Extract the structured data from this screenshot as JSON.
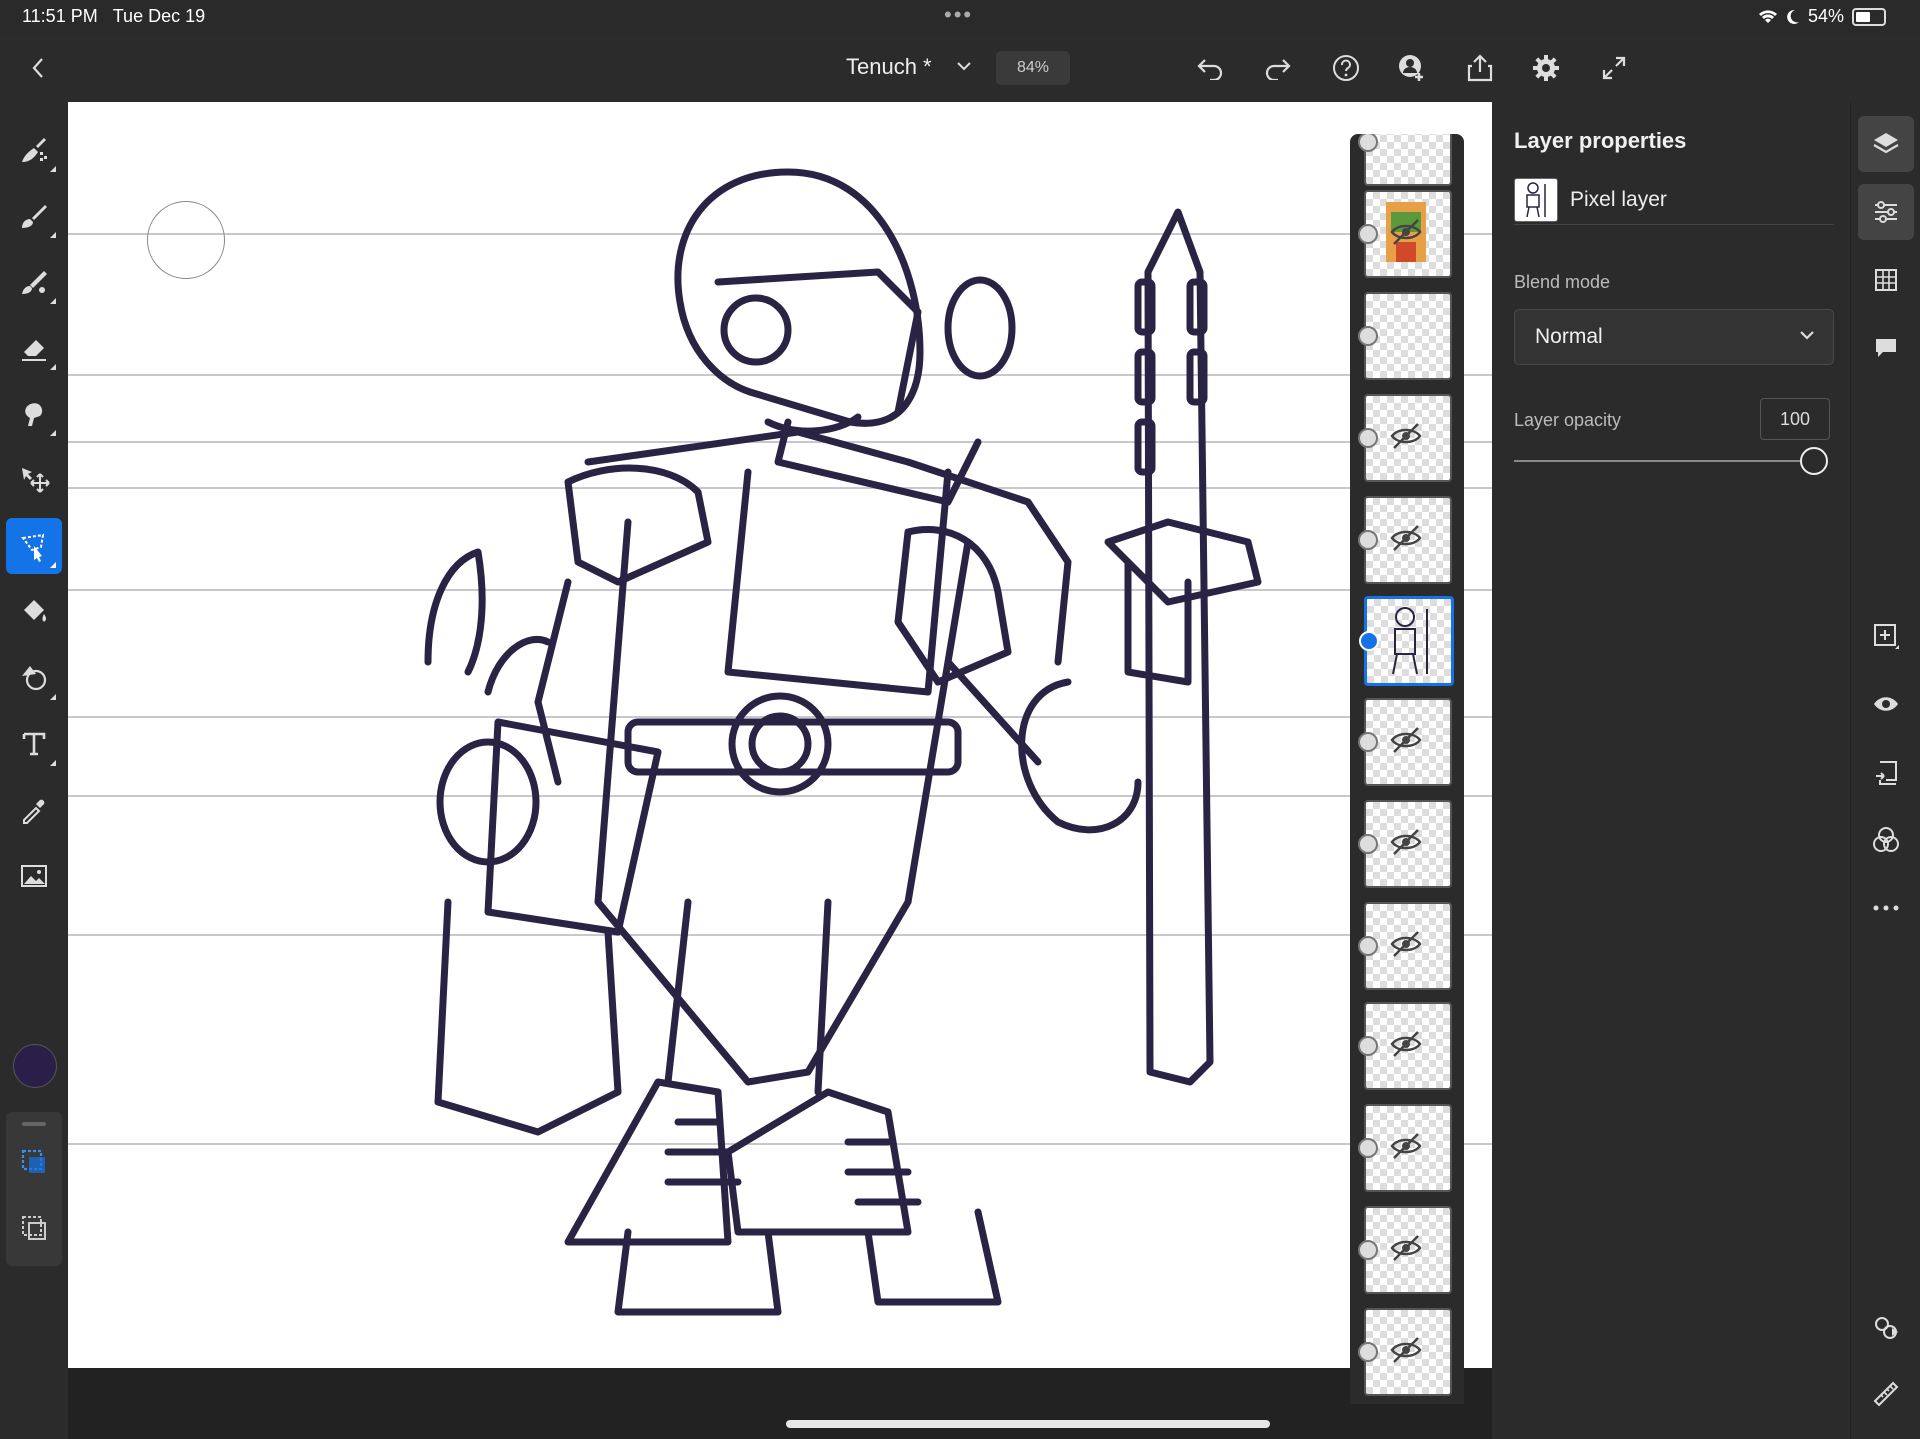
{
  "status_bar": {
    "time": "11:51 PM",
    "date": "Tue Dec 19",
    "battery": "54%"
  },
  "top_bar": {
    "document_title": "Tenuch *",
    "zoom": "84%",
    "icons": [
      "undo-icon",
      "redo-icon",
      "help-icon",
      "invite-icon",
      "share-icon",
      "settings-icon",
      "fullscreen-icon"
    ]
  },
  "left_tools": [
    "pixel-brush",
    "live-brush",
    "vector-brush",
    "eraser",
    "smudge",
    "transform",
    "selection",
    "fill",
    "shape",
    "text",
    "eyedropper",
    "place-image"
  ],
  "current_color": "#2a1f48",
  "accent_color": "#1473e6",
  "properties": {
    "title": "Layer properties",
    "layer_type": "Pixel layer",
    "blend_mode_label": "Blend mode",
    "blend_mode": "Normal",
    "opacity_label": "Layer opacity",
    "opacity": "100"
  },
  "layers": [
    {
      "selected": false,
      "hidden": true
    },
    {
      "selected": false,
      "hidden": true
    },
    {
      "selected": false,
      "hidden": false
    },
    {
      "selected": false,
      "hidden": true
    },
    {
      "selected": false,
      "hidden": true
    },
    {
      "selected": true,
      "hidden": false
    },
    {
      "selected": false,
      "hidden": true
    },
    {
      "selected": false,
      "hidden": true
    },
    {
      "selected": false,
      "hidden": true
    },
    {
      "selected": false,
      "hidden": true
    },
    {
      "selected": false,
      "hidden": true
    },
    {
      "selected": false,
      "hidden": true
    },
    {
      "selected": false,
      "hidden": true
    }
  ],
  "right_rail": [
    "layers-icon",
    "properties-icon",
    "grid-icon",
    "comment-icon",
    "add-layer-icon",
    "visibility-icon",
    "merge-down-icon",
    "blend-icon",
    "more-icon",
    "adjustments-icon",
    "ruler-icon"
  ]
}
